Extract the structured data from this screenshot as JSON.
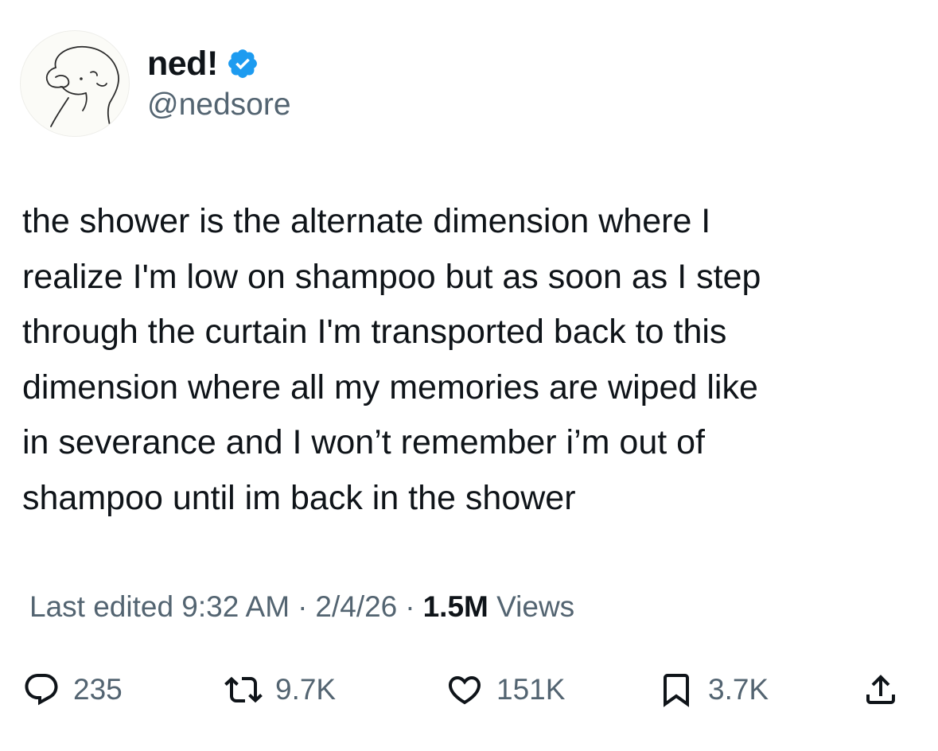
{
  "author": {
    "display_name": "ned!",
    "handle": "@nedsore",
    "verified": true,
    "verified_color": "#1d9bf0"
  },
  "tweet": {
    "text": "the shower is the alternate dimension where I\nrealize I'm low on shampoo but as soon as I step\nthrough the curtain I'm transported back to this\ndimension where all my memories are wiped like\nin severance and I won’t remember i’m out of\nshampoo until im back in the shower"
  },
  "meta": {
    "edited_label": "Last edited 9:32 AM",
    "separator": "·",
    "date": "2/4/26",
    "views_count": "1.5M",
    "views_label": "Views"
  },
  "actions": {
    "reply": {
      "icon": "reply-icon",
      "count": "235"
    },
    "retweet": {
      "icon": "retweet-icon",
      "count": "9.7K"
    },
    "like": {
      "icon": "heart-icon",
      "count": "151K"
    },
    "bookmark": {
      "icon": "bookmark-icon",
      "count": "3.7K"
    },
    "share": {
      "icon": "share-icon"
    }
  },
  "colors": {
    "text_primary": "#0f1419",
    "text_secondary": "#536471",
    "background": "#ffffff"
  }
}
